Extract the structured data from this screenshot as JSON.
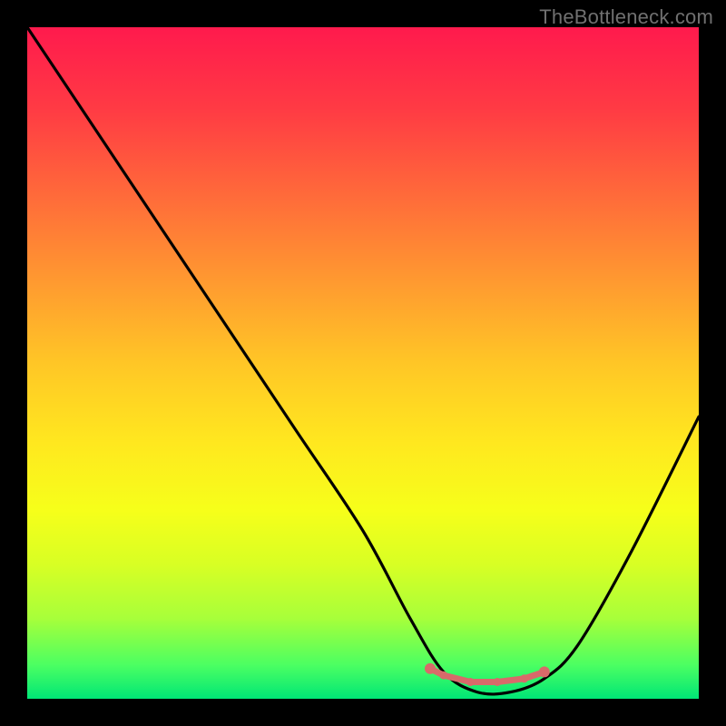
{
  "watermark": "TheBottleneck.com",
  "chart_data": {
    "type": "line",
    "title": "",
    "xlabel": "",
    "ylabel": "",
    "xlim": [
      0,
      100
    ],
    "ylim": [
      0,
      100
    ],
    "series": [
      {
        "name": "bottleneck-curve",
        "x": [
          0,
          10,
          20,
          30,
          40,
          50,
          57,
          62,
          67,
          72,
          77,
          82,
          90,
          100
        ],
        "values": [
          100,
          85,
          70,
          55,
          40,
          25,
          12,
          4,
          1,
          1,
          3,
          8,
          22,
          42
        ]
      }
    ],
    "highlight": {
      "name": "optimal-range",
      "color": "#d86a6a",
      "points_x": [
        60,
        62,
        66,
        70,
        74,
        77
      ],
      "points_y": [
        4.5,
        3.5,
        2.5,
        2.5,
        3,
        4
      ]
    },
    "background": {
      "gradient_stops": [
        {
          "pos": 0,
          "color": "#ff1a4d"
        },
        {
          "pos": 50,
          "color": "#ffc626"
        },
        {
          "pos": 75,
          "color": "#f6ff1a"
        },
        {
          "pos": 100,
          "color": "#00e676"
        }
      ]
    }
  }
}
